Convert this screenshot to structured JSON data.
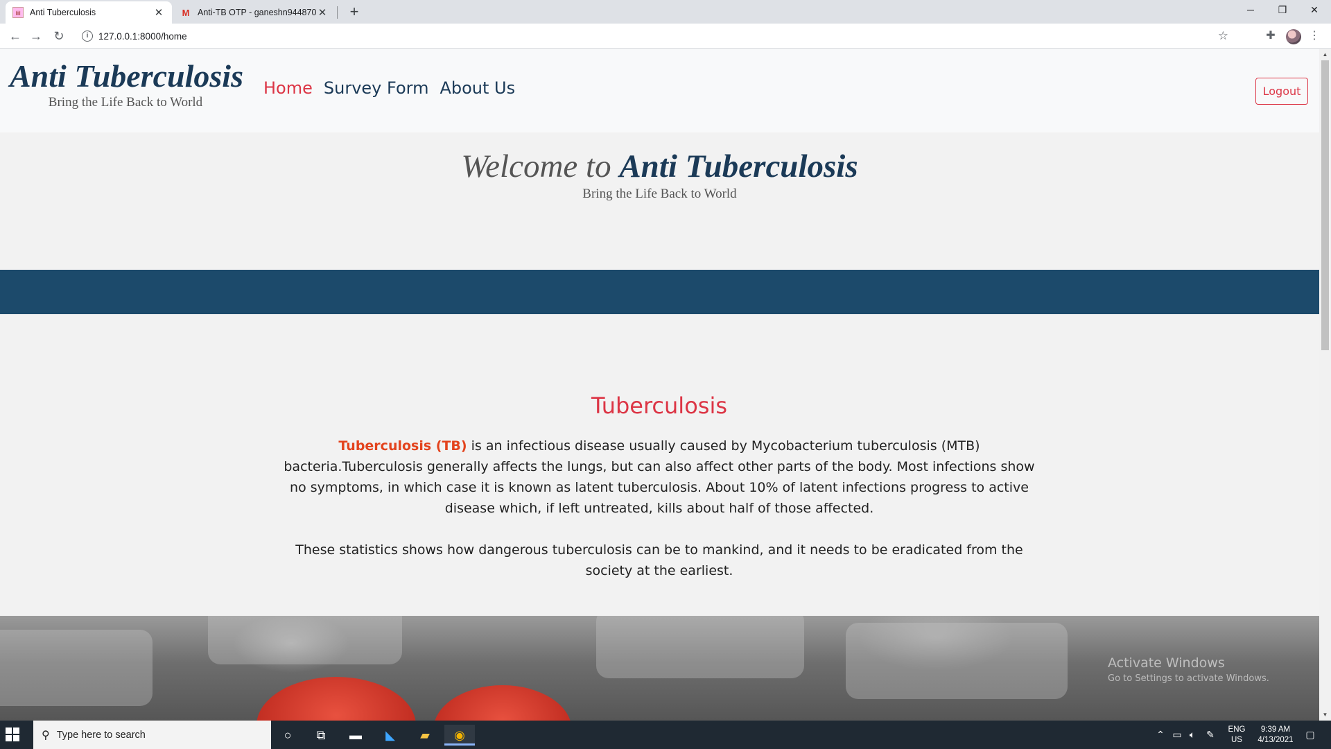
{
  "browser": {
    "tabs": [
      {
        "title": "Anti Tuberculosis",
        "active": true
      },
      {
        "title": "Anti-TB OTP - ganeshn944870@",
        "active": false
      }
    ],
    "url": "127.0.0.1:8000/home"
  },
  "navbar": {
    "brand_name": "Anti Tuberculosis",
    "brand_tagline": "Bring the Life Back to World",
    "links": [
      {
        "label": "Home",
        "active": true
      },
      {
        "label": "Survey Form",
        "active": false
      },
      {
        "label": "About Us",
        "active": false
      }
    ],
    "logout_label": "Logout"
  },
  "hero": {
    "welcome_prefix": "Welcome to ",
    "welcome_name": "Anti Tuberculosis",
    "tagline": "Bring the Life Back to World"
  },
  "content": {
    "heading": "Tuberculosis",
    "p1_highlight": "Tuberculosis (TB)",
    "p1_rest": " is an infectious disease usually caused by Mycobacterium tuberculosis (MTB) bacteria.Tuberculosis generally affects the lungs, but can also affect other parts of the body. Most infections show no symptoms, in which case it is known as latent tuberculosis. About 10% of latent infections progress to active disease which, if left untreated, kills about half of those affected.",
    "p2": "These statistics shows how dangerous tuberculosis can be to mankind, and it needs to be eradicated from the society at the earliest."
  },
  "watermark": {
    "title": "Activate Windows",
    "subtitle": "Go to Settings to activate Windows."
  },
  "taskbar": {
    "search_placeholder": "Type here to search",
    "lang": "ENG",
    "region": "US",
    "time": "9:39 AM",
    "date": "4/13/2021"
  },
  "colors": {
    "brand_navy": "#1b3a57",
    "accent_red": "#dc3545",
    "band_blue": "#1c4a6b",
    "highlight_orange": "#e3431d"
  }
}
